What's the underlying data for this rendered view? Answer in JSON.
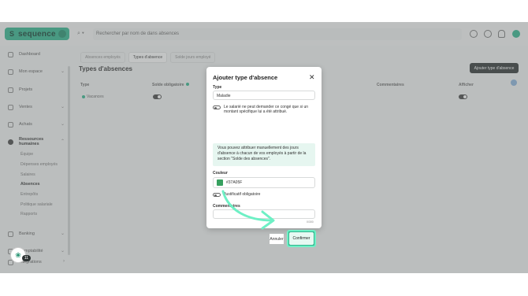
{
  "app": {
    "logo_mark": "S",
    "logo_text": "sequence",
    "search_placeholder": "Rechercher par nom de dans absences",
    "colors": {
      "brand": "#2fb58d",
      "dark_button": "#2d3333",
      "info_bg": "#e6f6f0",
      "highlight": "#6ef0c5"
    }
  },
  "sidebar": {
    "items": [
      {
        "label": "Dashboard",
        "icon": "dashboard-icon"
      },
      {
        "label": "Mon espace",
        "icon": "user-icon"
      },
      {
        "label": "Projets",
        "icon": "folder-icon"
      },
      {
        "label": "Ventes",
        "icon": "cart-icon"
      },
      {
        "label": "Achats",
        "icon": "bag-icon"
      },
      {
        "label": "Ressources humaines",
        "icon": "people-icon"
      }
    ],
    "subitems": [
      "Équipe",
      "Dépenses employés",
      "Salaires",
      "Absences",
      "Entrepôts",
      "Politique salariale",
      "Rapports"
    ],
    "bottom_items": [
      {
        "label": "Banking",
        "icon": "bank-icon"
      },
      {
        "label": "Comptabilité",
        "icon": "ledger-icon"
      },
      {
        "label": "Intégrations",
        "icon": "plug-icon"
      }
    ]
  },
  "main": {
    "tabs": [
      "Absences employés",
      "Types d'absence",
      "Solde jours employé"
    ],
    "title": "Types d'absences",
    "add_button": "Ajouter type d'absence",
    "columns": [
      "Type",
      "Solde obligatoire",
      "Commentaires",
      "Afficher"
    ],
    "rows": [
      {
        "type": "Vacances"
      }
    ]
  },
  "modal": {
    "title": "Ajouter type d'absence",
    "type_label": "Type",
    "type_value": "Maladie",
    "toggle1_text": "Le salarié ne peut demander ce congé que si un montant spécifique lui a été attribué.",
    "info_text": "Vous pouvez attribuer manuellement des jours d'absence à chacun de vos employés à partir de la section \"Solde des absences\".",
    "color_label": "Couleur",
    "color_value": "#37A05F",
    "toggle2_text": "Justificatif obligatoire",
    "comments_label": "Commentaires",
    "counter": "0/300",
    "cancel_label": "Annuler",
    "confirm_label": "Confirmer"
  },
  "chat": {
    "badge": "11"
  }
}
